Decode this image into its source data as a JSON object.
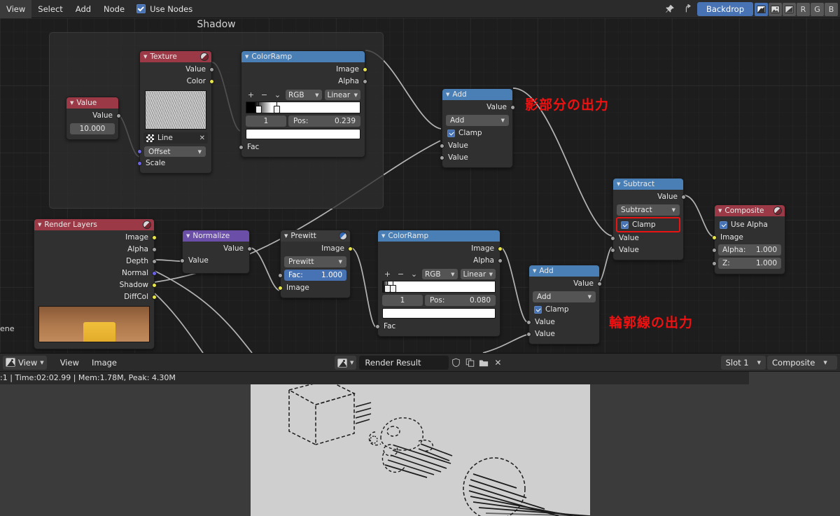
{
  "header": {
    "menus": [
      "View",
      "Select",
      "Add",
      "Node"
    ],
    "use_nodes_label": "Use Nodes",
    "use_nodes_checked": true,
    "pin_icon": "pin-icon",
    "parent_icon": "go-to-parent-icon",
    "backdrop_label": "Backdrop",
    "channel_buttons": [
      "color-channel",
      "image-channel",
      "alpha-channel",
      "R",
      "G",
      "B"
    ],
    "accent_color": "#4772b3"
  },
  "node_editor": {
    "frame_label": "Shadow",
    "annotations": [
      {
        "text": "影部分の出力",
        "color": "#ee1111"
      },
      {
        "text": "輪郭線の出力",
        "color": "#ee1111"
      }
    ],
    "scene_text": "ene",
    "nodes": {
      "value": {
        "title": "Value",
        "outputs": [
          "Value"
        ],
        "field_value": "10.000"
      },
      "texture": {
        "title": "Texture",
        "outputs": [
          "Value",
          "Color"
        ],
        "datablock": "Line",
        "inputs": [
          "Offset",
          "Scale"
        ],
        "offset_label": "Offset",
        "scale_label": "Scale"
      },
      "colorramp1": {
        "title": "ColorRamp",
        "outputs": [
          "Image",
          "Alpha"
        ],
        "add_btn": "+",
        "remove_btn": "−",
        "menu_btn": "v",
        "color_mode": "RGB",
        "interpolation": "Linear",
        "index": "1",
        "pos_label": "Pos:",
        "pos_value": "0.239",
        "inputs": [
          "Fac"
        ]
      },
      "add1": {
        "title": "Add",
        "outputs": [
          "Value"
        ],
        "operation": "Add",
        "clamp_label": "Clamp",
        "clamp_checked": true,
        "inputs": [
          "Value",
          "Value"
        ]
      },
      "render_layers": {
        "title": "Render Layers",
        "outputs": [
          "Image",
          "Alpha",
          "Depth",
          "Normal",
          "Shadow",
          "DiffCol"
        ]
      },
      "normalize": {
        "title": "Normalize",
        "outputs": [
          "Value"
        ],
        "inputs": [
          "Value"
        ]
      },
      "prewitt": {
        "title": "Prewitt",
        "outputs": [
          "Image"
        ],
        "filter_type": "Prewitt",
        "fac_label": "Fac:",
        "fac_value": "1.000",
        "inputs": [
          "Image"
        ]
      },
      "colorramp2": {
        "title": "ColorRamp",
        "outputs": [
          "Image",
          "Alpha"
        ],
        "add_btn": "+",
        "remove_btn": "−",
        "menu_btn": "v",
        "color_mode": "RGB",
        "interpolation": "Linear",
        "index": "1",
        "pos_label": "Pos:",
        "pos_value": "0.080",
        "inputs": [
          "Fac"
        ]
      },
      "add2": {
        "title": "Add",
        "outputs": [
          "Value"
        ],
        "operation": "Add",
        "clamp_label": "Clamp",
        "clamp_checked": true,
        "inputs": [
          "Value",
          "Value"
        ]
      },
      "subtract": {
        "title": "Subtract",
        "outputs": [
          "Value"
        ],
        "operation": "Subtract",
        "clamp_label": "Clamp",
        "clamp_checked": true,
        "clamp_highlighted": true,
        "inputs": [
          "Value",
          "Value"
        ]
      },
      "composite": {
        "title": "Composite",
        "use_alpha_label": "Use Alpha",
        "use_alpha_checked": true,
        "image_label": "Image",
        "alpha_label": "Alpha:",
        "alpha_value": "1.000",
        "z_label": "Z:",
        "z_value": "1.000"
      }
    }
  },
  "image_editor": {
    "editor_type_icon": "image-editor-icon",
    "view_dropdown": "View",
    "menus": [
      "View",
      "Image"
    ],
    "image_icon": "image-datablock-icon",
    "image_name": "Render Result",
    "fake_user_icon": "shield-icon",
    "new_copy_icon": "duplicate-icon",
    "open_icon": "folder-icon",
    "unlink_icon": "close-icon",
    "slot": "Slot 1",
    "layer": "Composite"
  },
  "viewport": {
    "render_status": ":1 | Time:02:02.99 | Mem:1.78M, Peak: 4.30M"
  }
}
